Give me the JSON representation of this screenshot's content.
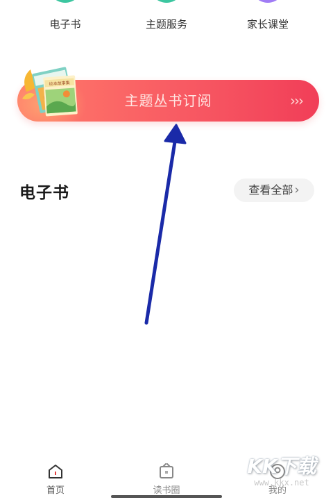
{
  "categories": [
    {
      "label": "电子书",
      "icon": "ebook-icon",
      "color": "#3cc6a0"
    },
    {
      "label": "主题服务",
      "icon": "theme-service-icon",
      "color": "#3cc6a0"
    },
    {
      "label": "家长课堂",
      "icon": "parent-class-icon",
      "color": "#a07cf5"
    }
  ],
  "banner": {
    "title": "主题丛书订阅",
    "arrows": "›››",
    "book_cover_text": "绘本故事集"
  },
  "section": {
    "title": "电子书",
    "view_all": "查看全部",
    "view_all_chevron": "›"
  },
  "annotation": {
    "color": "#1a2aa8",
    "type": "arrow-pointing-to-banner"
  },
  "bottom_nav": [
    {
      "label": "首页",
      "icon": "home-icon",
      "active": true
    },
    {
      "label": "读书圈",
      "icon": "reading-circle-icon",
      "active": false
    },
    {
      "label": "我的",
      "icon": "profile-icon",
      "active": false
    }
  ],
  "watermark": {
    "main": "KK下载",
    "url": "www.kkx.net"
  }
}
